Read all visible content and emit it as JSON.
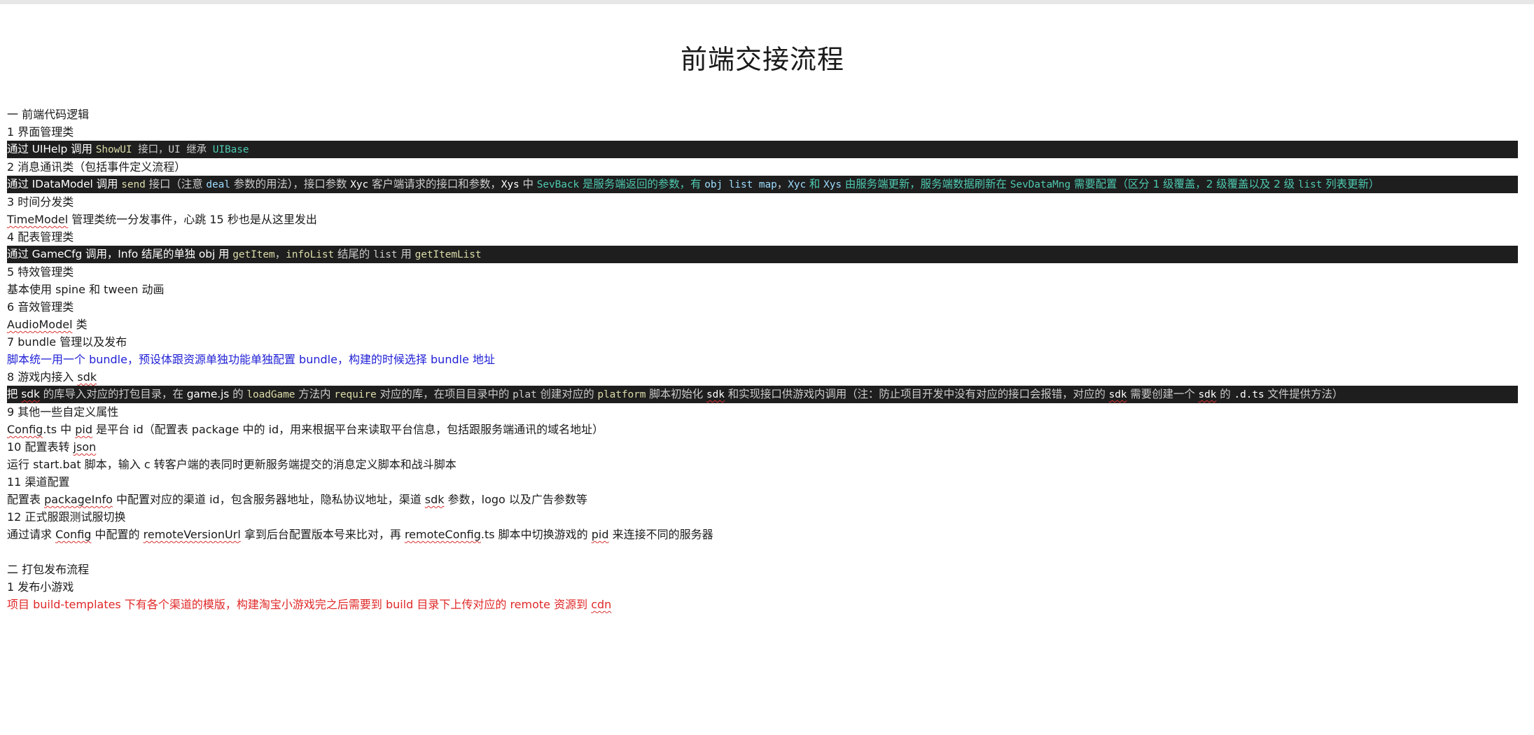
{
  "title": "前端交接流程",
  "section1": {
    "heading": "一  前端代码逻辑",
    "items": {
      "ui": {
        "heading": "1  界面管理类",
        "p1": "通过 ",
        "w1": "UIHelp",
        "p2": " 调用 ",
        "w2": "ShowUI",
        "p3": " 接口，",
        "w3": "UI",
        "p4": " 继承 ",
        "w4": "UIBase"
      },
      "msg": {
        "heading": "2  消息通讯类（包括事件定义流程）",
        "t1": "通过 ",
        "t2": "IDataModel",
        "t3": " 调用 ",
        "t4": "send",
        "t5": " 接口（注意 ",
        "t6": "deal",
        "t7": " 参数的用法），接口参数 ",
        "t8": "Xyc",
        "t9": " 客户端请求的接口和参数，",
        "t10": "Xys",
        "t11": " 中 ",
        "t12": "SevBack",
        "t13": " 是服务端返回的参数，有 ",
        "t14": "obj list map",
        "t15": "，",
        "t16": "Xyc",
        "t17": " 和 ",
        "t18": "Xys",
        "t19": " 由服务端更新，服务端数据刷新在 ",
        "t20": "SevDataMng",
        "t21": " 需要配置（区分 1 级覆盖，2 级覆盖以及 2 级 ",
        "t22": "list",
        "t23": " 列表更新）"
      },
      "time": {
        "heading": "3  时间分发类",
        "p1": "TimeModel",
        "p2": " 管理类统一分发事件，心跳 15 秒也是从这里发出"
      },
      "cfg": {
        "heading": "4  配表管理类",
        "t1": "通过 ",
        "t2": "GameCfg",
        "t3": " 调用，",
        "t4": "Info",
        "t5": " 结尾的单独 ",
        "t6": "obj",
        "t7": " 用 ",
        "t8": "getItem",
        "t9": "，",
        "t10": "infoList",
        "t11": " 结尾的 ",
        "t12": "list",
        "t13": " 用 ",
        "t14": "getItemList"
      },
      "fx": {
        "heading": "5  特效管理类",
        "text": "基本使用 spine 和 tween 动画"
      },
      "audio": {
        "heading": "6 音效管理类",
        "p1": "AudioModel",
        "p2": " 类"
      },
      "bundle": {
        "heading": "7 bundle 管理以及发布",
        "text": "脚本统一用一个 bundle，预设体跟资源单独功能单独配置 bundle，构建的时候选择 bundle 地址"
      },
      "sdk": {
        "h1": "8  游戏内接入 ",
        "h2": "sdk",
        "t1": "把 ",
        "t2": "sdk",
        "t3": " 的库导入对应的打包目录，在 ",
        "t4": "game.js",
        "t5": " 的 ",
        "t6": "loadGame",
        "t7": " 方法内 ",
        "t8": "require",
        "t9": " 对应的库，在项目目录中的 ",
        "t10": "plat",
        "t11": " 创建对应的 ",
        "t12": "platform",
        "t13": " 脚本初始化 ",
        "t14": "sdk",
        "t15": " 和实现接口供游戏内调用（注：防止项目开发中没有对应的接口会报错，对应的 ",
        "t16": "sdk",
        "t17": " 需要创建一个 ",
        "t18": "sdk",
        "t19": " 的 ",
        "t20": ".d.ts",
        "t21": " 文件提供方法）"
      },
      "custom": {
        "heading": "9 其他一些自定义属性",
        "p1": "Config",
        "p2": ".ts 中 ",
        "p3": "pid",
        "p4": " 是平台 id（配置表 package 中的 id，用来根据平台来读取平台信息，包括跟服务端通讯的域名地址）"
      },
      "json": {
        "h1": "10  配置表转 ",
        "h2": "json",
        "text": "运行 start.bat 脚本，输入 c 转客户端的表同时更新服务端提交的消息定义脚本和战斗脚本"
      },
      "channel": {
        "heading": "11  渠道配置",
        "p1": "配置表 ",
        "p2": "packageInfo",
        "p3": " 中配置对应的渠道 id，包含服务器地址，隐私协议地址，渠道 ",
        "p4": "sdk",
        "p5": " 参数，logo 以及广告参数等"
      },
      "server": {
        "heading": "12  正式服跟测试服切换",
        "p1": "通过请求 ",
        "p2": "Config",
        "p3": " 中配置的 ",
        "p4": "remoteVersionUrl",
        "p5": " 拿到后台配置版本号来比对，再 ",
        "p6": "remoteConfig",
        "p7": ".ts 脚本中切换游戏的 ",
        "p8": "pid",
        "p9": " 来连接不同的服务器"
      }
    }
  },
  "section2": {
    "heading": "二  打包发布流程",
    "items": {
      "mini": {
        "heading": "1  发布小游戏",
        "p1": "项目 build-templates 下有各个渠道的模版，构建淘宝小游戏完之后需要到 build 目录下上传对应的 remote 资源到 ",
        "p2": "cdn"
      }
    }
  },
  "colors": {
    "code_bg": "#1e1e1e",
    "blue_text": "#1f1fd6",
    "red_text": "#e02828",
    "code_yellow": "#dcdcaa",
    "code_teal": "#4ec9b0"
  }
}
